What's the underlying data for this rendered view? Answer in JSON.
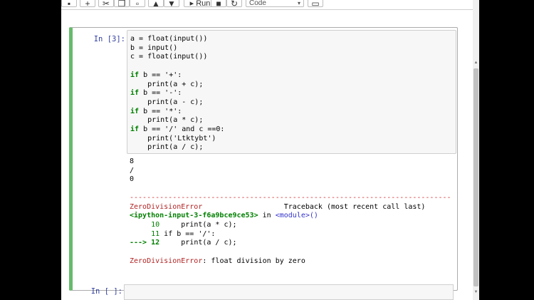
{
  "toolbar": {
    "run_label": "Run",
    "cell_type": "Code"
  },
  "cell1": {
    "prompt": "In [3]:"
  },
  "cell2": {
    "prompt": "In [ ]:"
  },
  "code_lines": [
    "a = float(input())",
    "b = input()",
    "c = float(input())",
    "",
    "if b == '+':",
    "    print(a + c);",
    "if b == '-':",
    "    print(a - c);",
    "if b == '*':",
    "    print(a * c);",
    "if b == '/' and c ==0:",
    "    print('Ltktybt')",
    "    print(a / c);"
  ],
  "output_lines": [
    "8",
    "/",
    "0"
  ],
  "traceback": {
    "separator": "---------------------------------------------------------------------------",
    "error_name": "ZeroDivisionError",
    "header_right": "Traceback (most recent call last)",
    "file": "<ipython-input-3-f6a9bce9ce53>",
    "in_word": " in ",
    "module": "<module>",
    "module_suffix": "()",
    "line10_no": "     10",
    "line10_code": "     print(a * c);",
    "line11_no": "     11",
    "line11_code": " if b == '/':",
    "arrow": "---> 12",
    "line12_code": "     print(a / c);",
    "final_name": "ZeroDivisionError",
    "final_msg": ": float division by zero"
  }
}
